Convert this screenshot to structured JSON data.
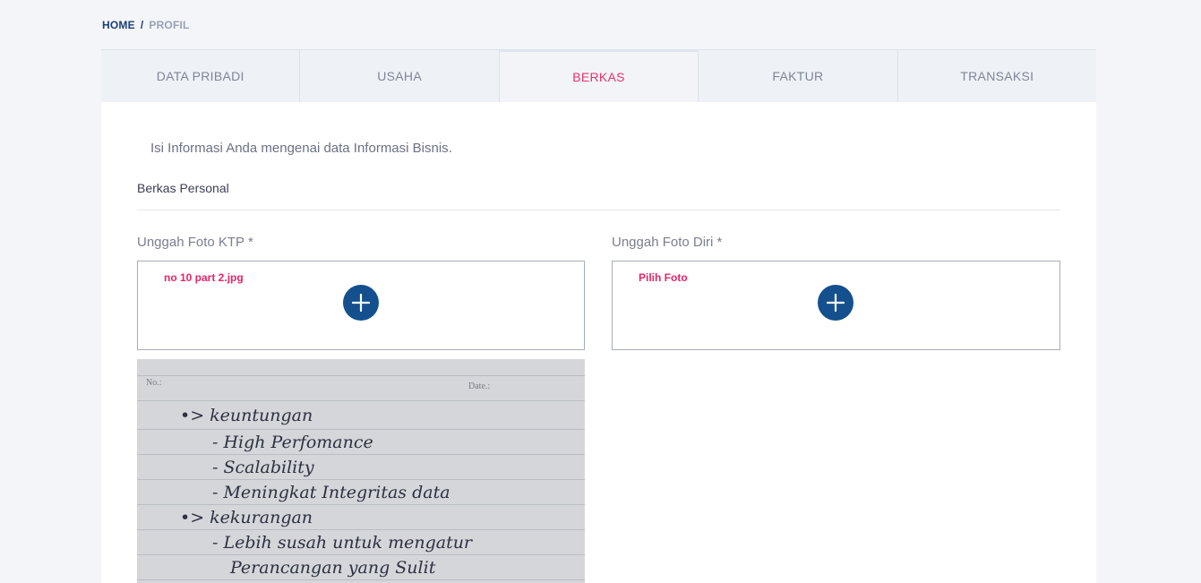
{
  "breadcrumb": {
    "home": "HOME",
    "separator": "/",
    "current": "PROFIL"
  },
  "tabs": [
    {
      "label": "DATA PRIBADI",
      "active": false
    },
    {
      "label": "USAHA",
      "active": false
    },
    {
      "label": "BERKAS",
      "active": true
    },
    {
      "label": "FAKTUR",
      "active": false
    },
    {
      "label": "TRANSAKSI",
      "active": false
    }
  ],
  "content": {
    "intro": "Isi Informasi Anda mengenai data Informasi Bisnis.",
    "section_title": "Berkas Personal",
    "ktp": {
      "label": "Unggah Foto KTP *",
      "filename": "no 10 part 2.jpg"
    },
    "selfie": {
      "label": "Unggah Foto Diri *",
      "filename": "Pilih Foto"
    },
    "preview": {
      "header_no": "No.:",
      "header_date": "Date.:",
      "lines": [
        "•> keuntungan",
        "- High Perfomance",
        "- Scalability",
        "- Meningkat Integritas data",
        "•> kekurangan",
        "- Lebih susah untuk mengatur",
        "Perancangan yang Sulit"
      ]
    }
  },
  "colors": {
    "accent": "#e6336f",
    "primary": "#14508e",
    "breadcrumb": "#1a3f7a"
  },
  "icons": {
    "add": "plus-circle-icon"
  }
}
